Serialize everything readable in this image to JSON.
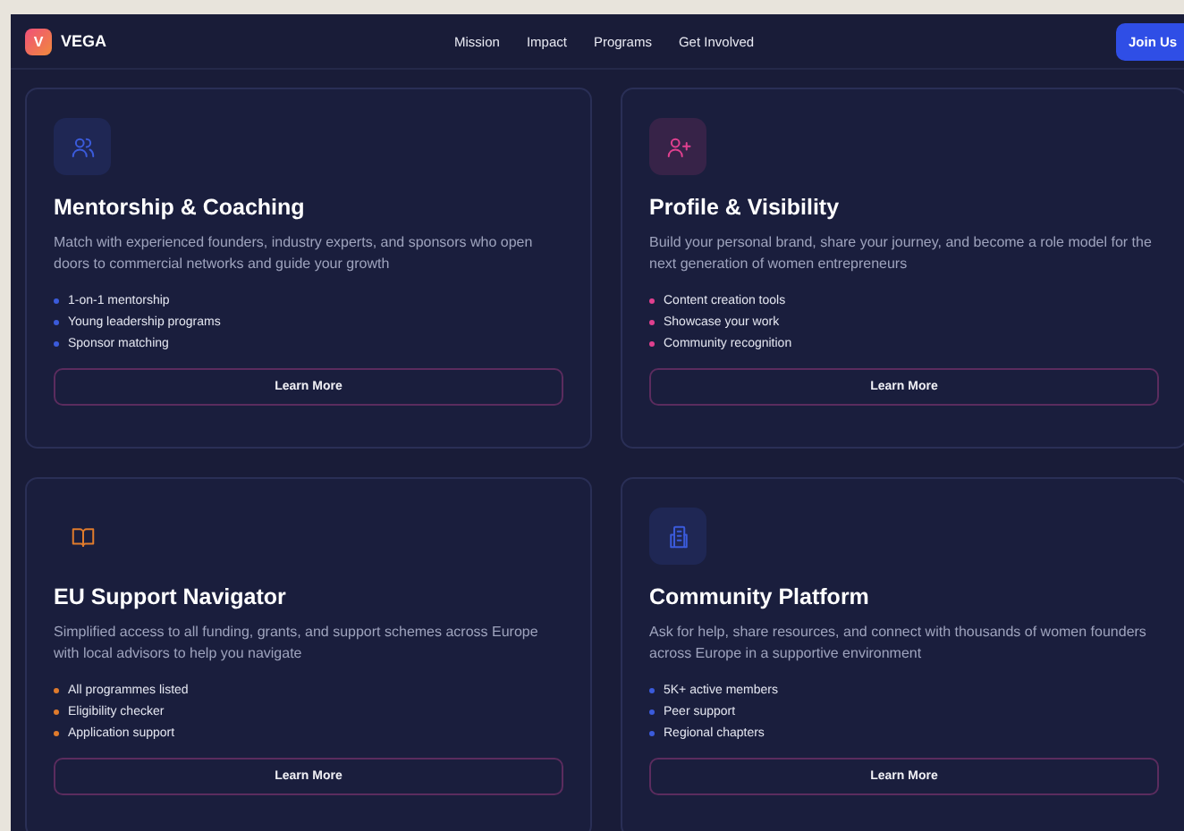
{
  "nav": {
    "logo_letter": "V",
    "brand": "VEGA",
    "links": [
      "Mission",
      "Impact",
      "Programs",
      "Get Involved"
    ],
    "cta": "Join Us"
  },
  "cards": [
    {
      "kind": "people",
      "icon_tile": true,
      "color": "#3b5bdb",
      "title": "Mentorship & Coaching",
      "description": "Match with experienced founders, industry experts, and sponsors who open doors to commercial networks and guide your growth",
      "features": [
        "1-on-1 mentorship",
        "Young leadership programs",
        "Sponsor matching"
      ],
      "button": "Learn More"
    },
    {
      "kind": "user-plus",
      "icon_tile": true,
      "color": "#e0408f",
      "title": "Profile & Visibility",
      "description": "Build your personal brand, share your journey, and become a role model for the next generation of women entrepreneurs",
      "features": [
        "Content creation tools",
        "Showcase your work",
        "Community recognition"
      ],
      "button": "Learn More"
    },
    {
      "kind": "book",
      "icon_tile": false,
      "color": "#e07b2c",
      "title": "EU Support Navigator",
      "description": "Simplified access to all funding, grants, and support schemes across Europe with local advisors to help you navigate",
      "features": [
        "All programmes listed",
        "Eligibility checker",
        "Application support"
      ],
      "button": "Learn More"
    },
    {
      "kind": "building",
      "icon_tile": true,
      "color": "#3b5bdb",
      "title": "Community Platform",
      "description": "Ask for help, share resources, and connect with thousands of women founders across Europe in a supportive environment",
      "features": [
        "5K+ active members",
        "Peer support",
        "Regional chapters"
      ],
      "button": "Learn More"
    }
  ]
}
